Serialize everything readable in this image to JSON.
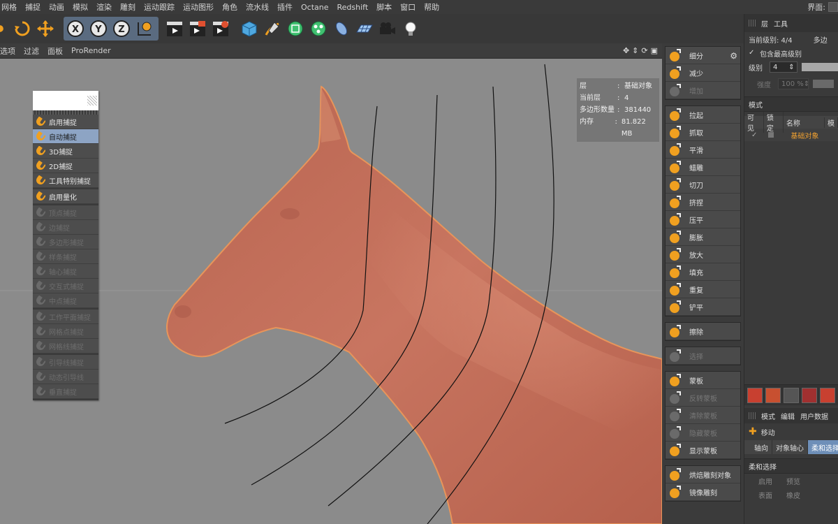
{
  "menu": {
    "items": [
      "网格",
      "捕捉",
      "动画",
      "模拟",
      "渲染",
      "雕刻",
      "运动跟踪",
      "运动图形",
      "角色",
      "流水线",
      "插件",
      "Octane",
      "Redshift",
      "脚本",
      "窗口",
      "帮助"
    ],
    "right_label": "界面:"
  },
  "viewport_menu": [
    "选项",
    "过滤",
    "面板",
    "ProRender"
  ],
  "hud": {
    "rows": [
      {
        "k": "层",
        "v": "基础对象"
      },
      {
        "k": "当前层",
        "v": "4"
      },
      {
        "k": "多边形数量",
        "v": "381440"
      },
      {
        "k": "内存",
        "v": "81.822 MB"
      }
    ],
    "sep": ":"
  },
  "snap_panel": {
    "groups": [
      [
        {
          "label": "启用捕捉",
          "state": "normal"
        },
        {
          "label": "自动捕捉",
          "state": "selected"
        },
        {
          "label": "3D捕捉",
          "state": "normal",
          "badge": "3D"
        },
        {
          "label": "2D捕捉",
          "state": "normal",
          "badge": "2D"
        },
        {
          "label": "工具特别捕捉",
          "state": "normal"
        }
      ],
      [
        {
          "label": "启用量化",
          "state": "normal"
        }
      ],
      [
        {
          "label": "顶点捕捉",
          "state": "disabled"
        },
        {
          "label": "边捕捉",
          "state": "disabled"
        },
        {
          "label": "多边形捕捉",
          "state": "disabled"
        },
        {
          "label": "样条捕捉",
          "state": "disabled"
        },
        {
          "label": "轴心捕捉",
          "state": "disabled"
        },
        {
          "label": "交互式捕捉",
          "state": "disabled"
        },
        {
          "label": "中点捕捉",
          "state": "disabled"
        }
      ],
      [
        {
          "label": "工作平面捕捉",
          "state": "disabled"
        },
        {
          "label": "网格点捕捉",
          "state": "disabled"
        },
        {
          "label": "网格线捕捉",
          "state": "disabled"
        }
      ],
      [
        {
          "label": "引导线捕捉",
          "state": "disabled"
        },
        {
          "label": "动态引导线",
          "state": "disabled"
        },
        {
          "label": "垂直捕捉",
          "state": "disabled"
        }
      ]
    ]
  },
  "brushes": {
    "groups": [
      [
        {
          "label": "细分",
          "state": "normal",
          "gear": "⚙"
        },
        {
          "label": "减少",
          "state": "normal"
        },
        {
          "label": "增加",
          "state": "disabled"
        }
      ],
      [
        {
          "label": "拉起",
          "state": "normal"
        },
        {
          "label": "抓取",
          "state": "normal"
        },
        {
          "label": "平滑",
          "state": "normal"
        },
        {
          "label": "蜡雕",
          "state": "normal"
        },
        {
          "label": "切刀",
          "state": "normal"
        },
        {
          "label": "挤捏",
          "state": "normal"
        },
        {
          "label": "压平",
          "state": "normal"
        },
        {
          "label": "膨胀",
          "state": "normal"
        },
        {
          "label": "放大",
          "state": "normal"
        },
        {
          "label": "填充",
          "state": "normal"
        },
        {
          "label": "重复",
          "state": "normal"
        },
        {
          "label": "铲平",
          "state": "normal"
        }
      ],
      [
        {
          "label": "擦除",
          "state": "normal"
        }
      ],
      [
        {
          "label": "选择",
          "state": "disabled"
        }
      ],
      [
        {
          "label": "蒙板",
          "state": "normal"
        },
        {
          "label": "反转蒙板",
          "state": "disabled"
        },
        {
          "label": "清除蒙板",
          "state": "disabled"
        },
        {
          "label": "隐藏蒙板",
          "state": "disabled"
        },
        {
          "label": "显示蒙板",
          "state": "normal"
        }
      ],
      [
        {
          "label": "烘焙雕刻对象",
          "state": "normal"
        },
        {
          "label": "镜像雕刻",
          "state": "normal"
        }
      ]
    ]
  },
  "right_panel": {
    "tabs": [
      "层",
      "工具"
    ],
    "current_level_label": "当前级别: 4/4",
    "current_level_suffix": "多边",
    "include_highest": "包含最高级别",
    "level_label": "级别",
    "level_value": "4",
    "strength_label": "强度",
    "strength_value": "100 %",
    "mode_section": "模式",
    "columns": [
      "可见",
      "锁定",
      "名称",
      "模"
    ],
    "layer_name": "基础对象",
    "attr_tabs": [
      "模式",
      "编辑",
      "用户数据"
    ],
    "tool_name": "移动",
    "segments": [
      "轴向",
      "对象轴心",
      "柔和选择"
    ],
    "soft_section": "柔和选择",
    "opt_row1": [
      "启用",
      "预览"
    ],
    "opt_row2": [
      "表面",
      "橡皮"
    ]
  },
  "colors": {
    "horse": "#c56e58",
    "horse_edge": "#e8955a",
    "viewport_bg": "#8b8b8b",
    "accent_blue": "#8da4c4",
    "layer_orange": "#f0a030"
  }
}
